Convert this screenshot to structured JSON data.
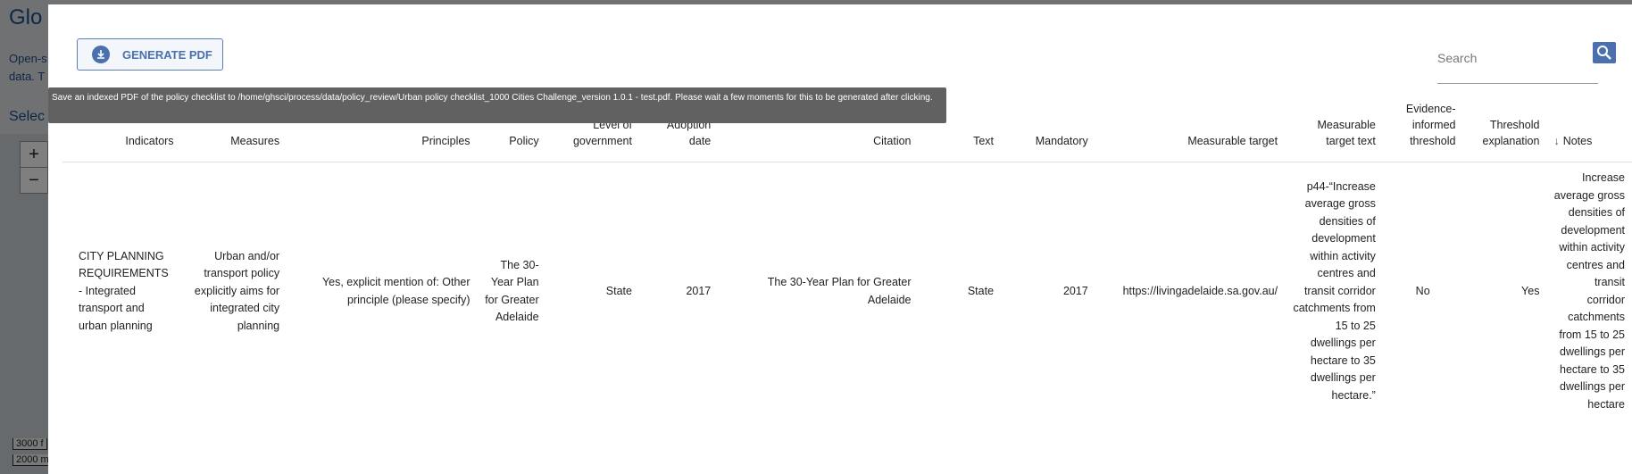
{
  "background": {
    "title": "Glo",
    "description": "Open-s data. T",
    "select_label": "Selec",
    "zoom_in": "+",
    "zoom_out": "−",
    "scale_1": "3000 f",
    "scale_2": "2000 m"
  },
  "toolbar": {
    "pdf_button_label": "GENERATE PDF",
    "pdf_icon": "download-icon"
  },
  "tooltip": {
    "text": "Save an indexed PDF of the policy checklist to /home/ghsci/process/data/policy_review/Urban policy checklist_1000 Cities Challenge_version 1.0.1 - test.pdf. Please wait a few moments for this to be generated after clicking."
  },
  "search": {
    "placeholder": "Search",
    "icon": "search-icon"
  },
  "colors": {
    "accent": "#4a71ad",
    "tooltip_bg": "#616161",
    "overlay": "rgba(0,0,0,0.5)"
  },
  "table": {
    "headers": [
      "Indicators",
      "Measures",
      "Principles",
      "Policy",
      "Level of government",
      "Adoption date",
      "Citation",
      "Text",
      "Mandatory",
      "Measurable target",
      "Measurable target text",
      "Evidence-informed threshold",
      "Threshold explanation",
      "Notes"
    ],
    "sort_icon": "arrow-down-icon",
    "rows": [
      [
        "CITY PLANNING REQUIREMENTS - Integrated transport and urban planning",
        "Urban and/or transport policy explicitly aims for integrated city planning",
        "Yes, explicit mention of: Other principle (please specify)",
        "The 30-Year Plan for Greater Adelaide",
        "State",
        "2017",
        "The 30-Year Plan for Greater Adelaide",
        "State",
        "2017",
        "https://livingadelaide.sa.gov.au/",
        "p44-“Increase average gross densities of development within activity centres and transit corridor catchments from 15 to 25 dwellings per hectare to 35 dwellings per hectare.”",
        "No",
        "Yes",
        "Increase average gross densities of development within activity centres and transit corridor catchments from 15 to 25 dwellings per hectare to 35 dwellings per hectare"
      ]
    ]
  }
}
